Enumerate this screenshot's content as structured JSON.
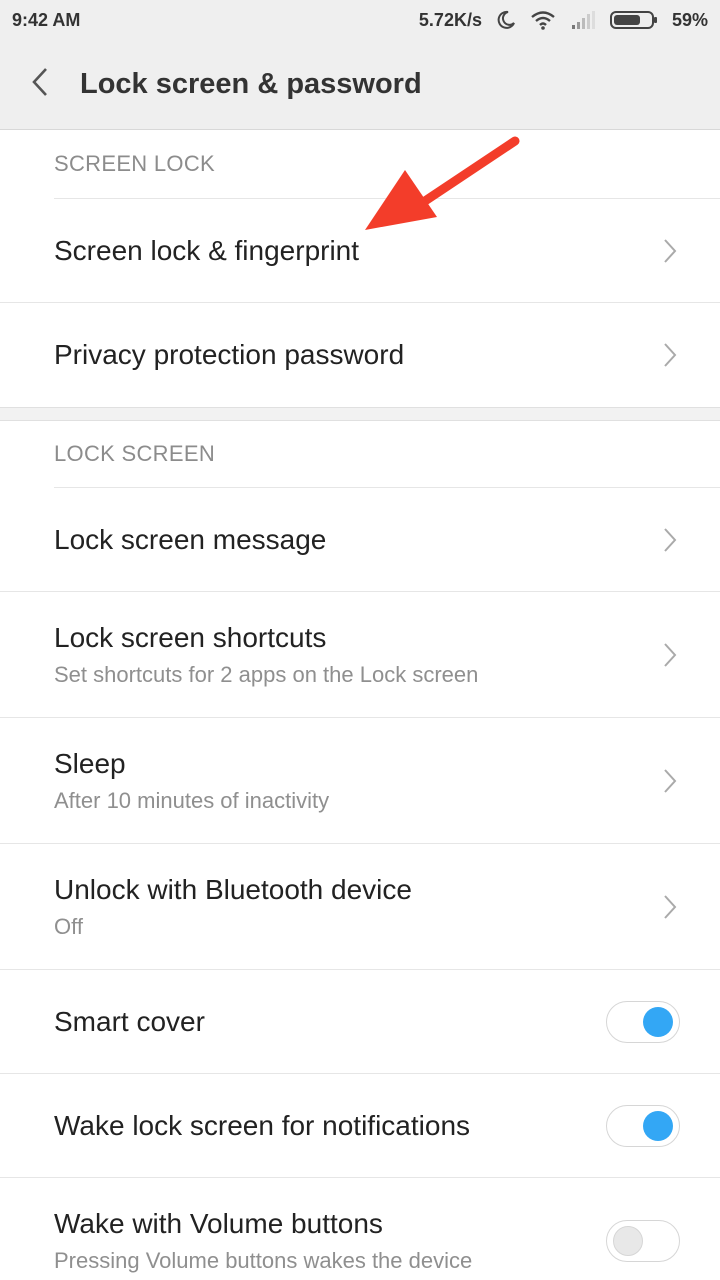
{
  "status_bar": {
    "time": "9:42 AM",
    "speed": "5.72K/s",
    "battery": "59%",
    "icons": [
      "moon-icon",
      "wifi-icon",
      "signal-icon",
      "battery-icon"
    ]
  },
  "app_bar": {
    "title": "Lock screen & password",
    "back_icon": "chevron-left-icon"
  },
  "sections": {
    "screen_lock": {
      "header": "SCREEN LOCK",
      "items": [
        {
          "title": "Screen lock & fingerprint"
        },
        {
          "title": "Privacy protection password"
        }
      ]
    },
    "lock_screen": {
      "header": "LOCK SCREEN",
      "items": [
        {
          "title": "Lock screen message"
        },
        {
          "title": "Lock screen shortcuts",
          "subtitle": "Set shortcuts for 2 apps on the Lock screen"
        },
        {
          "title": "Sleep",
          "subtitle": "After 10 minutes of inactivity"
        },
        {
          "title": "Unlock with Bluetooth device",
          "subtitle": "Off"
        },
        {
          "title": "Smart cover",
          "toggle": "on"
        },
        {
          "title": "Wake lock screen for notifications",
          "toggle": "on"
        },
        {
          "title": "Wake with Volume buttons",
          "subtitle": "Pressing Volume buttons wakes the device",
          "toggle": "off"
        }
      ]
    }
  },
  "colors": {
    "accent": "#33a7f5",
    "annotation_arrow": "#f33d2a",
    "header_bg": "#efefef"
  }
}
